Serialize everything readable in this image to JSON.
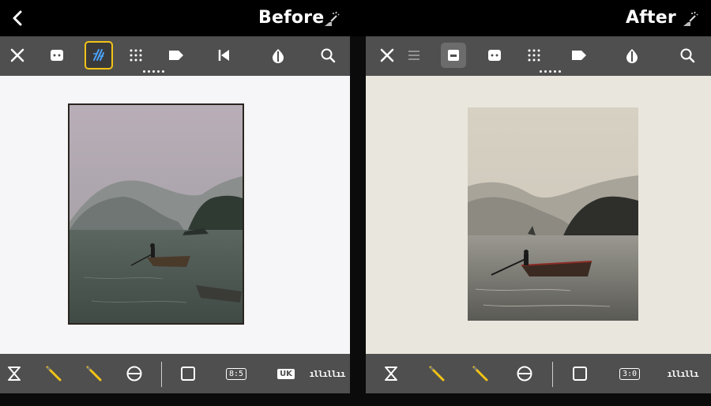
{
  "header": {
    "before_title": "Before",
    "after_title": "After"
  },
  "left_panel": {
    "toolbar_icons": [
      "close-icon",
      "face-icon",
      "sparkle-filter-icon",
      "grid-icon",
      "tag-icon",
      "audio-icon",
      "drop-icon",
      "search-icon"
    ],
    "bottom": {
      "ratio_label": "8:5",
      "chip_label": "UK",
      "hist_label": "ıllıllıı"
    }
  },
  "right_panel": {
    "toolbar_icons": [
      "close-icon",
      "menu-icon",
      "crop-box-icon",
      "face-icon",
      "grid-icon",
      "tag-icon",
      "drop-icon",
      "search-icon"
    ],
    "bottom": {
      "ratio_label": "3:0",
      "hist_label": "ıllıllı"
    }
  },
  "colors": {
    "toolbar": "#4f4f4f",
    "accent": "#f2c316",
    "before_bg": "#f6f6f8",
    "after_bg": "#e9e6dd"
  }
}
